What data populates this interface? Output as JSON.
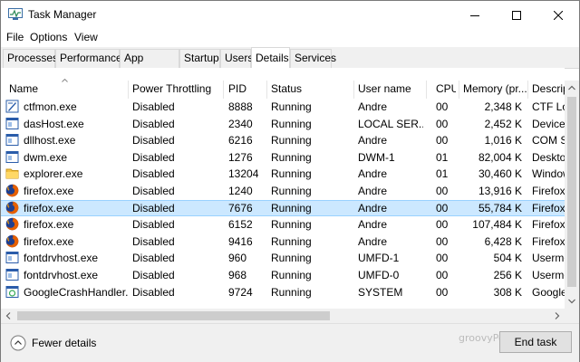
{
  "window": {
    "title": "Task Manager"
  },
  "menu": [
    "File",
    "Options",
    "View"
  ],
  "tabs": [
    "Processes",
    "Performance",
    "App history",
    "Startup",
    "Users",
    "Details",
    "Services"
  ],
  "active_tab": "Details",
  "columns": [
    "Name",
    "Power Throttling",
    "PID",
    "Status",
    "User name",
    "CPU",
    "Memory (pr...",
    "Descrip"
  ],
  "rows": [
    {
      "name": "ctfmon.exe",
      "throttling": "Disabled",
      "pid": "8888",
      "status": "Running",
      "user": "Andre",
      "cpu": "00",
      "memory": "2,348 K",
      "desc": "CTF Loa",
      "icon": "ctfmon-icon"
    },
    {
      "name": "dasHost.exe",
      "throttling": "Disabled",
      "pid": "2340",
      "status": "Running",
      "user": "LOCAL SER...",
      "cpu": "00",
      "memory": "2,452 K",
      "desc": "Device",
      "icon": "generic-exe-icon"
    },
    {
      "name": "dllhost.exe",
      "throttling": "Disabled",
      "pid": "6216",
      "status": "Running",
      "user": "Andre",
      "cpu": "00",
      "memory": "1,016 K",
      "desc": "COM S",
      "icon": "generic-exe-icon"
    },
    {
      "name": "dwm.exe",
      "throttling": "Disabled",
      "pid": "1276",
      "status": "Running",
      "user": "DWM-1",
      "cpu": "01",
      "memory": "82,004 K",
      "desc": "Deskto",
      "icon": "generic-exe-icon"
    },
    {
      "name": "explorer.exe",
      "throttling": "Disabled",
      "pid": "13204",
      "status": "Running",
      "user": "Andre",
      "cpu": "01",
      "memory": "30,460 K",
      "desc": "Window",
      "icon": "explorer-folder-icon"
    },
    {
      "name": "firefox.exe",
      "throttling": "Disabled",
      "pid": "1240",
      "status": "Running",
      "user": "Andre",
      "cpu": "00",
      "memory": "13,916 K",
      "desc": "Firefox",
      "icon": "firefox-icon"
    },
    {
      "name": "firefox.exe",
      "throttling": "Disabled",
      "pid": "7676",
      "status": "Running",
      "user": "Andre",
      "cpu": "00",
      "memory": "55,784 K",
      "desc": "Firefox",
      "icon": "firefox-icon",
      "selected": true
    },
    {
      "name": "firefox.exe",
      "throttling": "Disabled",
      "pid": "6152",
      "status": "Running",
      "user": "Andre",
      "cpu": "00",
      "memory": "107,484 K",
      "desc": "Firefox",
      "icon": "firefox-icon"
    },
    {
      "name": "firefox.exe",
      "throttling": "Disabled",
      "pid": "9416",
      "status": "Running",
      "user": "Andre",
      "cpu": "00",
      "memory": "6,428 K",
      "desc": "Firefox",
      "icon": "firefox-icon"
    },
    {
      "name": "fontdrvhost.exe",
      "throttling": "Disabled",
      "pid": "960",
      "status": "Running",
      "user": "UMFD-1",
      "cpu": "00",
      "memory": "504 K",
      "desc": "Usermo",
      "icon": "generic-exe-icon"
    },
    {
      "name": "fontdrvhost.exe",
      "throttling": "Disabled",
      "pid": "968",
      "status": "Running",
      "user": "UMFD-0",
      "cpu": "00",
      "memory": "256 K",
      "desc": "Usermo",
      "icon": "generic-exe-icon"
    },
    {
      "name": "GoogleCrashHandler....",
      "throttling": "Disabled",
      "pid": "9724",
      "status": "Running",
      "user": "SYSTEM",
      "cpu": "00",
      "memory": "308 K",
      "desc": "Google",
      "icon": "google-crash-icon"
    }
  ],
  "footer": {
    "fewer_details": "Fewer details",
    "end_task": "End task",
    "watermark": "groovyPost.com"
  },
  "colors": {
    "selection": "#cce8ff",
    "selection_border": "#99d1ff",
    "firefox": "#e66000"
  }
}
